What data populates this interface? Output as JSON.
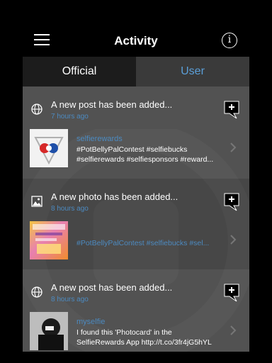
{
  "header": {
    "title": "Activity",
    "info_label": "i"
  },
  "tabs": [
    {
      "label": "Official"
    },
    {
      "label": "User"
    }
  ],
  "items": [
    {
      "title": "A new post has been added...",
      "time": "7 hours ago",
      "type_icon": "globe-icon",
      "author": "selfierewards",
      "message_line1": "#PotBellyPalContest #selfiebucks",
      "message_line2": "#selfierewards #selfiesponsors #reward..."
    },
    {
      "title": "A new photo has been added...",
      "time": "8 hours ago",
      "type_icon": "image-icon",
      "author": "",
      "message_line1": "#PotBellyPalContest #selfiebucks #sel..."
    },
    {
      "title": "A new post has been added...",
      "time": "8 hours ago",
      "type_icon": "globe-icon",
      "author": "myselfie",
      "message_line1": "I found this 'Photocard' in the",
      "message_line2": "SelfieRewards App http://t.co/3fr4jG5hYL"
    }
  ],
  "colors": {
    "accent_blue": "#4c8ac0",
    "background": "#000000",
    "feed_background": "#4a4a4a"
  }
}
